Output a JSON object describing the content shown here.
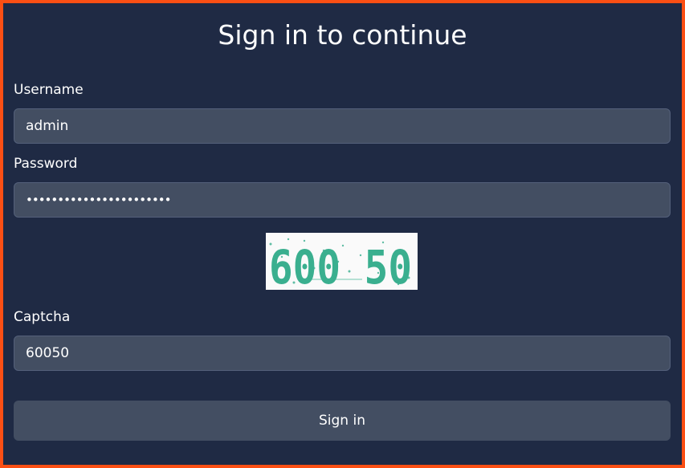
{
  "title": "Sign in to continue",
  "username": {
    "label": "Username",
    "value": "admin"
  },
  "password": {
    "label": "Password",
    "value": "•••••••••••••••••••••••"
  },
  "captcha_image": {
    "text": "600 50"
  },
  "captcha": {
    "label": "Captcha",
    "value": "60050"
  },
  "submit": {
    "label": "Sign in"
  },
  "colors": {
    "frame": "#fb4f14",
    "panel": "#1f2a44",
    "field": "#434e62",
    "captcha_ink": "#3aaf8f"
  }
}
